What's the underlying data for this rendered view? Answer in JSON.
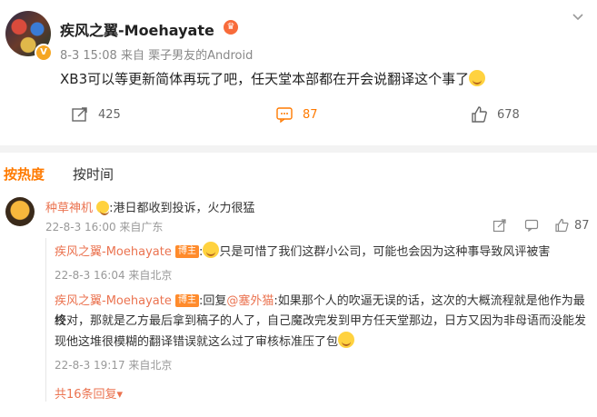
{
  "post": {
    "username": "疾风之翼-Moehayate",
    "meta": "8-3 15:08  来自 栗子男友的Android",
    "text": "XB3可以等更新简体再玩了吧，任天堂本部都在开会说翻译这个事了",
    "actions": {
      "repost_count": "425",
      "comment_count": "87",
      "like_count": "678"
    }
  },
  "tabs": {
    "hot": "按热度",
    "time": "按时间"
  },
  "comment": {
    "username": "种草神机",
    "text": ":港日都收到投诉，火力很猛",
    "meta": "22-8-3 16:00 来自广东",
    "like_count": "87"
  },
  "replies": [
    {
      "username": "疾风之翼-Moehayate",
      "badge": "博主",
      "text": "只是可惜了我们这群小公司，可能也会因为这种事导致风评被害",
      "meta": "22-8-3 16:04 来自北京"
    },
    {
      "username": "疾风之翼-Moehayate",
      "badge": "博主",
      "prefix": ":回复",
      "mention": "@塞外猫",
      "text1": ":如果那个人的吹逼无误的话，这次的大概流程就是他作为最终",
      "text2": "校对，那就是乙方最后拿到稿子的人了，自己魔改完发到甲方任天堂那边，日方又因为非母语而没能发",
      "text3": "现他这堆很模糊的翻译错误就这么过了审核标准压了包",
      "meta": "22-8-3 19:17 来自北京"
    }
  ],
  "more_replies": "共16条回复▾"
}
